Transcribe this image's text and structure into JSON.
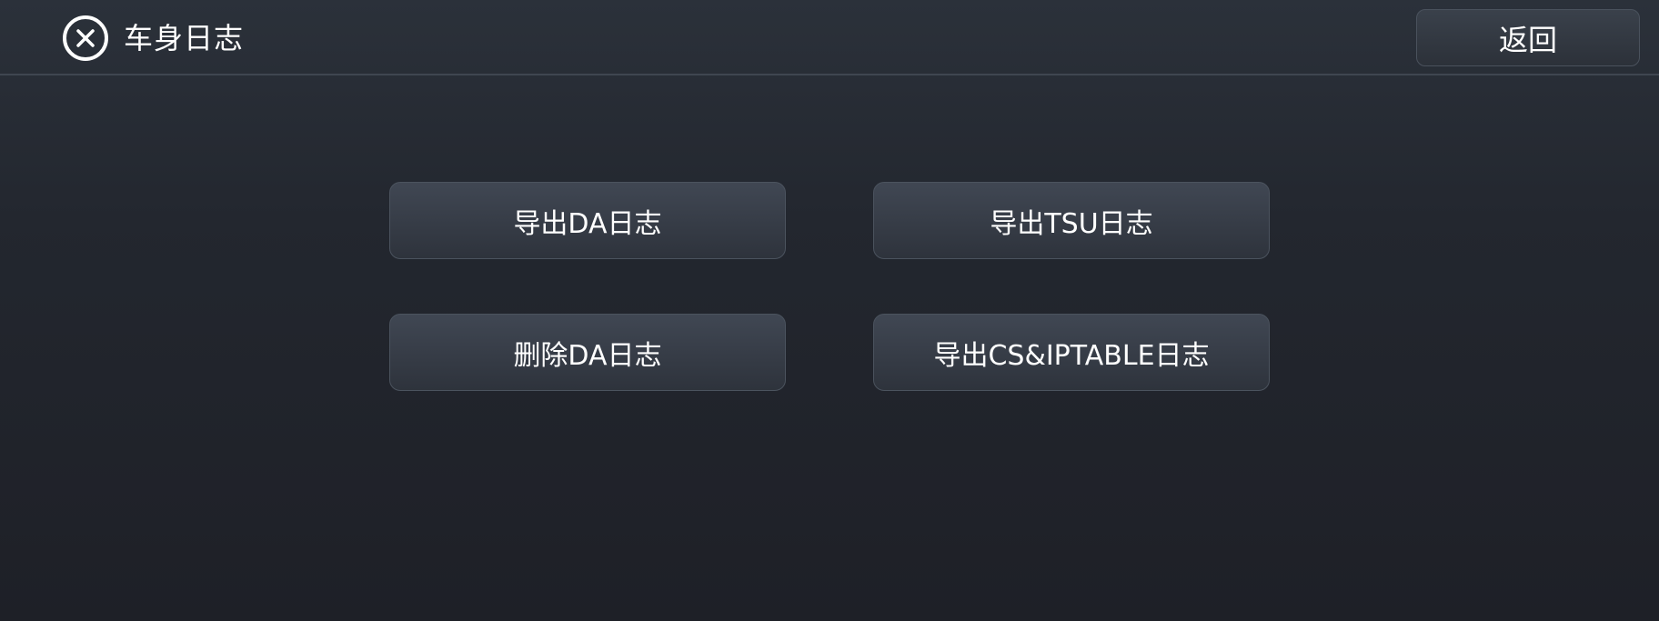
{
  "header": {
    "title": "车身日志",
    "close_icon": "close-circle-icon",
    "back_label": "返回"
  },
  "actions": [
    {
      "label": "导出DA日志"
    },
    {
      "label": "导出TSU日志"
    },
    {
      "label": "删除DA日志"
    },
    {
      "label": "导出CS&IPTABLE日志"
    }
  ],
  "colors": {
    "background_top": "#2b313a",
    "background_bottom": "#1e2027",
    "button_top": "#404753",
    "button_bottom": "#2e333c",
    "button_border": "#4b535e",
    "text": "#ffffff"
  }
}
